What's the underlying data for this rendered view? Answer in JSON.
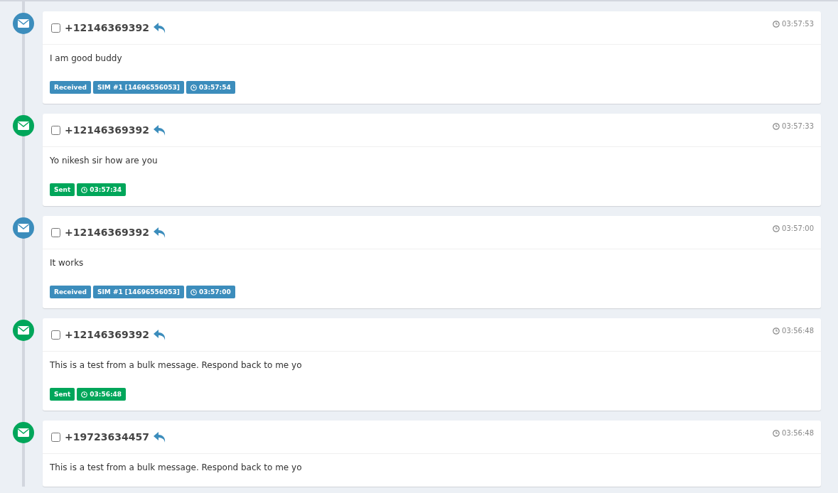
{
  "messages": [
    {
      "kind": "received",
      "checked": false,
      "number": "+12146369392",
      "time": "03:57:53",
      "text": "I am good buddy",
      "badges": [
        {
          "kind": "status",
          "label": "Received"
        },
        {
          "kind": "sim",
          "label": "SIM #1 [14696556053]"
        },
        {
          "kind": "time",
          "label": "03:57:54"
        }
      ]
    },
    {
      "kind": "sent",
      "checked": false,
      "number": "+12146369392",
      "time": "03:57:33",
      "text": "Yo nikesh sir how are you",
      "badges": [
        {
          "kind": "status",
          "label": "Sent"
        },
        {
          "kind": "time",
          "label": "03:57:34"
        }
      ]
    },
    {
      "kind": "received",
      "checked": false,
      "number": "+12146369392",
      "time": "03:57:00",
      "text": "It works",
      "badges": [
        {
          "kind": "status",
          "label": "Received"
        },
        {
          "kind": "sim",
          "label": "SIM #1 [14696556053]"
        },
        {
          "kind": "time",
          "label": "03:57:00"
        }
      ]
    },
    {
      "kind": "sent",
      "checked": false,
      "number": "+12146369392",
      "time": "03:56:48",
      "text": "This is a test from a bulk message. Respond back to me yo",
      "badges": [
        {
          "kind": "status",
          "label": "Sent"
        },
        {
          "kind": "time",
          "label": "03:56:48"
        }
      ]
    },
    {
      "kind": "sent",
      "checked": false,
      "number": "+19723634457",
      "time": "03:56:48",
      "text": "This is a test from a bulk message. Respond back to me yo"
    }
  ]
}
